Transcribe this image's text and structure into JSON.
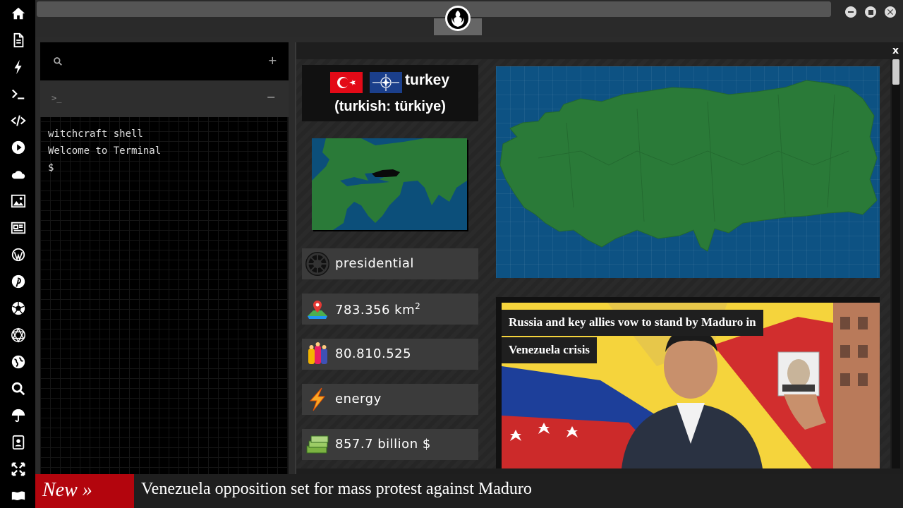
{
  "sidebar": {
    "icons": [
      "home-icon",
      "document-icon",
      "bolt-icon",
      "terminal-icon",
      "code-icon",
      "play-icon",
      "cloud-icon",
      "image-icon",
      "news-icon",
      "wordpress-icon",
      "pinterest-icon",
      "aperture-icon",
      "network-icon",
      "globe-icon",
      "search-icon",
      "umbrella-icon",
      "contact-icon",
      "expand-icon",
      "flag-icon"
    ]
  },
  "terminal": {
    "search_icon": "search-icon",
    "add_label": "+",
    "tab_prompt": ">_",
    "remove_label": "−",
    "lines": [
      "witchcraft shell",
      "Welcome to Terminal",
      "$"
    ]
  },
  "country": {
    "name": "turkey",
    "native": "(turkish: türkiye)",
    "government": "presidential",
    "area_value": "783.356 km",
    "area_unit_sup": "2",
    "population": "80.810.525",
    "resource": "energy",
    "gdp": "857.7 billion $"
  },
  "news": {
    "headline": "Russia and key allies vow to stand by Maduro in Venezuela crisis"
  },
  "ticker": {
    "badge": "New »",
    "text": "Venezuela opposition set for mass protest against Maduro"
  },
  "window": {
    "close_label": "x"
  },
  "colors": {
    "ticker_red": "#b3050d",
    "map_sea": "#0d5283",
    "map_land": "#2a7a38"
  }
}
